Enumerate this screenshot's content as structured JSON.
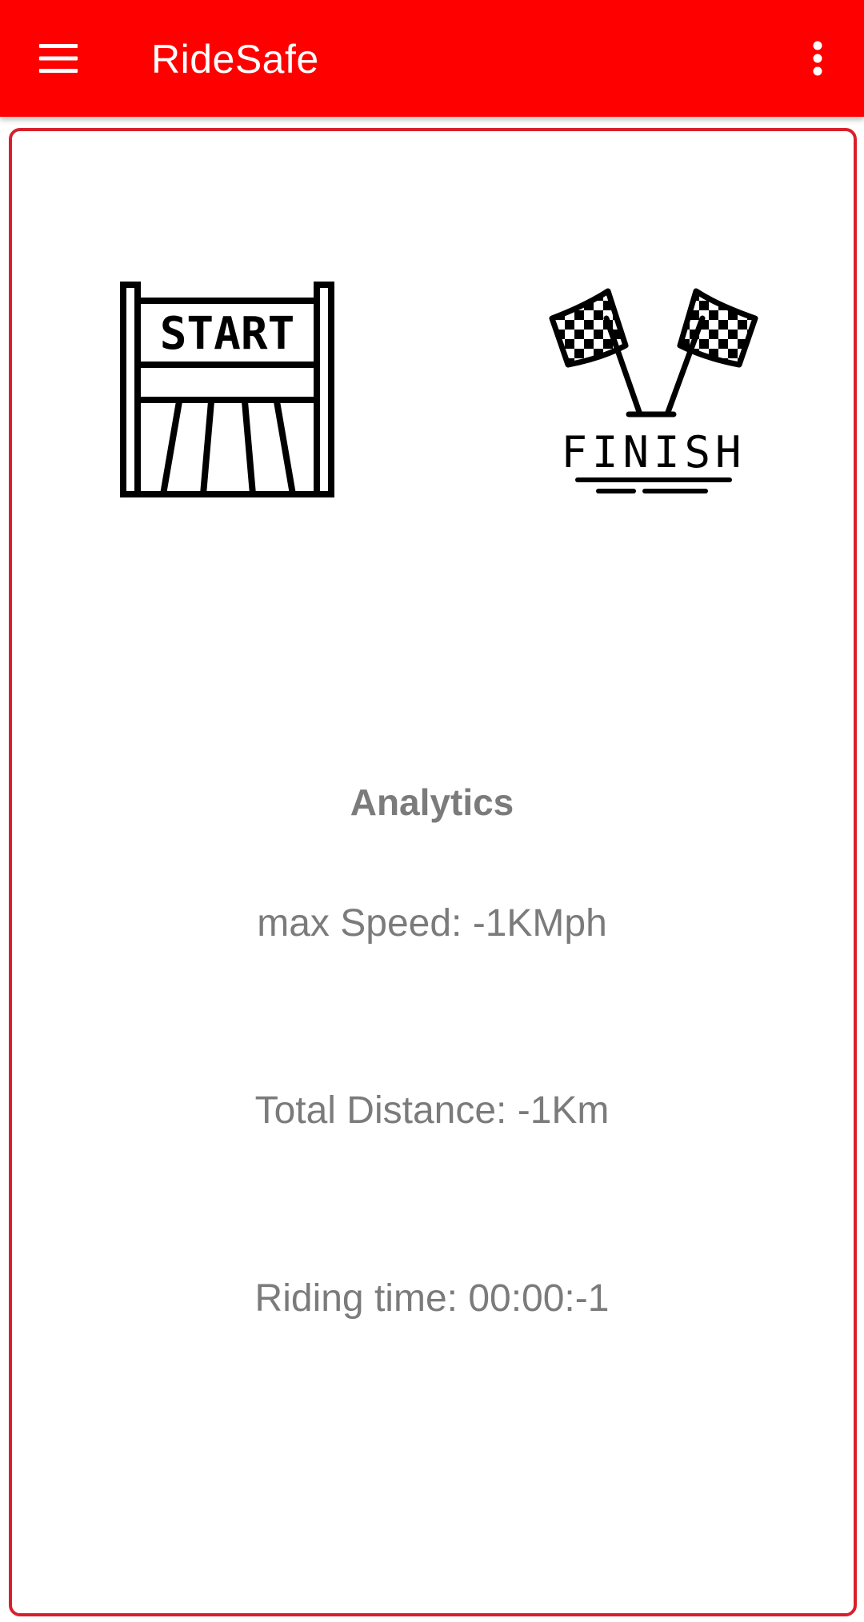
{
  "appbar": {
    "title": "RideSafe",
    "menu_icon": "hamburger-menu-icon",
    "overflow_icon": "more-vert-icon",
    "background_color": "#ff0000"
  },
  "card": {
    "border_color": "#d8202c",
    "start_icon": "start-gate-icon",
    "start_icon_text": "START",
    "finish_icon": "checkered-flags-icon",
    "finish_icon_text": "FINISH"
  },
  "analytics": {
    "title": "Analytics",
    "max_speed": "max Speed: -1KMph",
    "total_distance": "Total Distance: -1Km",
    "riding_time": "Riding time: 00:00:-1",
    "text_color": "#7b7b7b"
  }
}
